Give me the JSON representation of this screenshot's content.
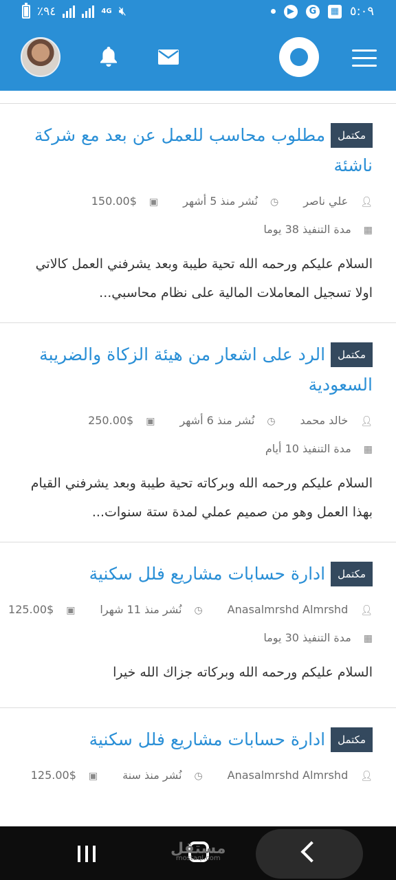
{
  "status_bar": {
    "battery": "٪٩٤",
    "network": "4G",
    "time": "٥:٠٩",
    "icons": [
      "battery-icon",
      "signal-icon",
      "signal-icon",
      "mute-icon",
      "dot-icon",
      "app-icon",
      "g-icon",
      "calendar-icon"
    ]
  },
  "header": {
    "avatar": "avatar",
    "icons": [
      "bell-icon",
      "mail-icon",
      "logo-icon",
      "menu-icon"
    ],
    "accent": "#2a8fd6"
  },
  "projects": [
    {
      "badge": "مكتمل",
      "title": "مطلوب محاسب للعمل عن بعد مع شركة ناشئة",
      "author": "علي ناصر",
      "posted": "نُشر منذ 5 أشهر",
      "budget": "$150.00",
      "duration": "مدة التنفيذ 38 يوما",
      "description": "السلام عليكم ورحمه الله تحية طيبة وبعد يشرفني العمل كالاتي اولا تسجيل المعاملات المالية على نظام محاسبي..."
    },
    {
      "badge": "مكتمل",
      "title": "الرد على اشعار من هيئة الزكاة والضريبة السعودية",
      "author": "خالد محمد",
      "posted": "نُشر منذ 6 أشهر",
      "budget": "$250.00",
      "duration": "مدة التنفيذ 10 أيام",
      "description": "السلام عليكم ورحمه الله وبركاته تحية طيبة وبعد يشرفني القيام بهذا العمل وهو من صميم عملي لمدة ستة سنوات..."
    },
    {
      "badge": "مكتمل",
      "title": "ادارة حسابات مشاريع فلل سكنية",
      "author": "Anasalmrshd Almrshd",
      "posted": "نُشر منذ 11 شهرا",
      "budget": "$125.00",
      "duration": "مدة التنفيذ 30 يوما",
      "description": "السلام عليكم ورحمه الله وبركاته جزاك الله خيرا"
    },
    {
      "badge": "مكتمل",
      "title": "ادارة حسابات مشاريع فلل سكنية",
      "author": "Anasalmrshd Almrshd",
      "posted": "نُشر منذ سنة",
      "budget": "$125.00",
      "duration": "",
      "description": ""
    }
  ],
  "nav_bar": {
    "watermark": "مستقل",
    "watermark_sub": "mostaql.com"
  }
}
